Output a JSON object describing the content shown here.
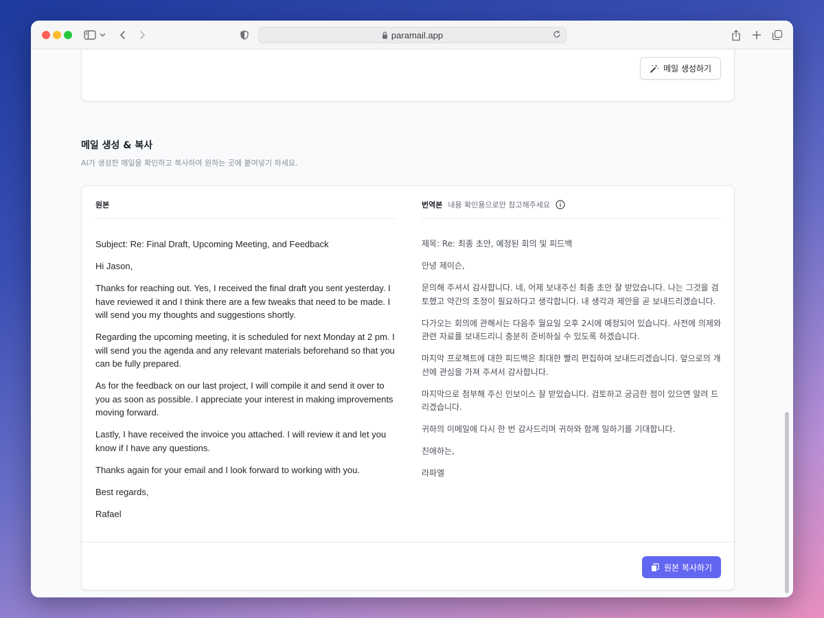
{
  "browser": {
    "url": "paramail.app"
  },
  "top_card": {
    "generate_button_label": "메일 생성하기"
  },
  "section": {
    "title": "메일 생성 & 복사",
    "subtitle": "AI가 생성한 메일을 확인하고 복사하여 원하는 곳에 붙여넣기 하세요."
  },
  "original": {
    "header": "원본",
    "paragraphs": [
      "Subject: Re: Final Draft, Upcoming Meeting, and Feedback",
      "Hi Jason,",
      "Thanks for reaching out. Yes, I received the final draft you sent yesterday. I have reviewed it and I think there are a few tweaks that need to be made. I will send you my thoughts and suggestions shortly.",
      "Regarding the upcoming meeting, it is scheduled for next Monday at 2 pm. I will send you the agenda and any relevant materials beforehand so that you can be fully prepared.",
      "As for the feedback on our last project, I will compile it and send it over to you as soon as possible. I appreciate your interest in making improvements moving forward.",
      "Lastly, I have received the invoice you attached. I will review it and let you know if I have any questions.",
      "Thanks again for your email and I look forward to working with you.",
      "Best regards,",
      "Rafael"
    ]
  },
  "translation": {
    "header": "번역본",
    "note": "내용 확인용으로만 참고해주세요",
    "paragraphs": [
      "제목: Re: 최종 초안, 예정된 회의 및 피드백",
      "안녕 제이슨,",
      "문의해 주셔서 감사합니다. 네, 어제 보내주신 최종 초안 잘 받았습니다. 나는 그것을 검토했고 약간의 조정이 필요하다고 생각합니다. 내 생각과 제안을 곧 보내드리겠습니다.",
      "다가오는 회의에 관해서는 다음주 월요일 오후 2시에 예정되어 있습니다. 사전에 의제와 관련 자료를 보내드리니 충분히 준비하실 수 있도록 하겠습니다.",
      "마지막 프로젝트에 대한 피드백은 최대한 빨리 편집하여 보내드리겠습니다. 앞으로의 개선에 관심을 가져 주셔서 감사합니다.",
      "마지막으로 첨부해 주신 인보이스 잘 받았습니다. 검토하고 궁금한 점이 있으면 알려 드리겠습니다.",
      "귀하의 이메일에 다시 한 번 감사드리며 귀하와 함께 일하기를 기대합니다.",
      "친애하는,",
      "라파엘"
    ]
  },
  "footer": {
    "copy_button_label": "원본 복사하기"
  },
  "colors": {
    "accent": "#6366f1"
  }
}
